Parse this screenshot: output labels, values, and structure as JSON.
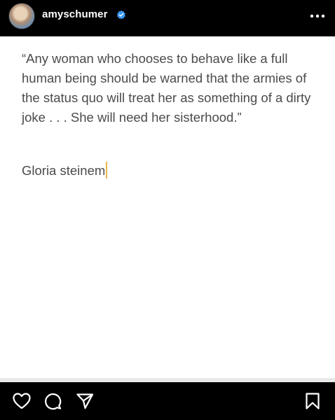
{
  "header": {
    "username": "amyschumer",
    "verified_color": "#3897f0"
  },
  "post": {
    "quote": "“Any woman who chooses to behave like a full human being should be warned that the armies of the status quo will treat her as something of a dirty joke . . . She will need her sisterhood.”",
    "author": "Gloria steinem"
  },
  "icons": [
    "avatar",
    "verified-badge-icon",
    "more-options-icon",
    "heart-icon",
    "comment-icon",
    "share-icon",
    "bookmark-icon"
  ]
}
